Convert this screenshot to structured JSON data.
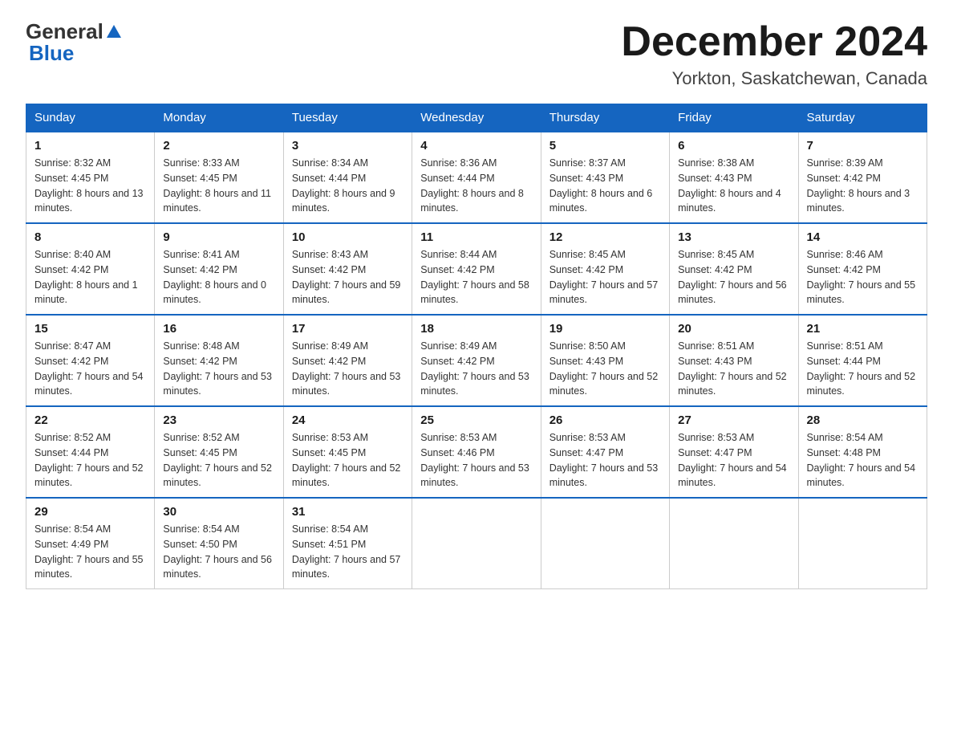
{
  "logo": {
    "part1": "General",
    "part2": "Blue"
  },
  "title": {
    "month_year": "December 2024",
    "location": "Yorkton, Saskatchewan, Canada"
  },
  "weekdays": [
    "Sunday",
    "Monday",
    "Tuesday",
    "Wednesday",
    "Thursday",
    "Friday",
    "Saturday"
  ],
  "weeks": [
    [
      {
        "day": "1",
        "sunrise": "8:32 AM",
        "sunset": "4:45 PM",
        "daylight": "8 hours and 13 minutes."
      },
      {
        "day": "2",
        "sunrise": "8:33 AM",
        "sunset": "4:45 PM",
        "daylight": "8 hours and 11 minutes."
      },
      {
        "day": "3",
        "sunrise": "8:34 AM",
        "sunset": "4:44 PM",
        "daylight": "8 hours and 9 minutes."
      },
      {
        "day": "4",
        "sunrise": "8:36 AM",
        "sunset": "4:44 PM",
        "daylight": "8 hours and 8 minutes."
      },
      {
        "day": "5",
        "sunrise": "8:37 AM",
        "sunset": "4:43 PM",
        "daylight": "8 hours and 6 minutes."
      },
      {
        "day": "6",
        "sunrise": "8:38 AM",
        "sunset": "4:43 PM",
        "daylight": "8 hours and 4 minutes."
      },
      {
        "day": "7",
        "sunrise": "8:39 AM",
        "sunset": "4:42 PM",
        "daylight": "8 hours and 3 minutes."
      }
    ],
    [
      {
        "day": "8",
        "sunrise": "8:40 AM",
        "sunset": "4:42 PM",
        "daylight": "8 hours and 1 minute."
      },
      {
        "day": "9",
        "sunrise": "8:41 AM",
        "sunset": "4:42 PM",
        "daylight": "8 hours and 0 minutes."
      },
      {
        "day": "10",
        "sunrise": "8:43 AM",
        "sunset": "4:42 PM",
        "daylight": "7 hours and 59 minutes."
      },
      {
        "day": "11",
        "sunrise": "8:44 AM",
        "sunset": "4:42 PM",
        "daylight": "7 hours and 58 minutes."
      },
      {
        "day": "12",
        "sunrise": "8:45 AM",
        "sunset": "4:42 PM",
        "daylight": "7 hours and 57 minutes."
      },
      {
        "day": "13",
        "sunrise": "8:45 AM",
        "sunset": "4:42 PM",
        "daylight": "7 hours and 56 minutes."
      },
      {
        "day": "14",
        "sunrise": "8:46 AM",
        "sunset": "4:42 PM",
        "daylight": "7 hours and 55 minutes."
      }
    ],
    [
      {
        "day": "15",
        "sunrise": "8:47 AM",
        "sunset": "4:42 PM",
        "daylight": "7 hours and 54 minutes."
      },
      {
        "day": "16",
        "sunrise": "8:48 AM",
        "sunset": "4:42 PM",
        "daylight": "7 hours and 53 minutes."
      },
      {
        "day": "17",
        "sunrise": "8:49 AM",
        "sunset": "4:42 PM",
        "daylight": "7 hours and 53 minutes."
      },
      {
        "day": "18",
        "sunrise": "8:49 AM",
        "sunset": "4:42 PM",
        "daylight": "7 hours and 53 minutes."
      },
      {
        "day": "19",
        "sunrise": "8:50 AM",
        "sunset": "4:43 PM",
        "daylight": "7 hours and 52 minutes."
      },
      {
        "day": "20",
        "sunrise": "8:51 AM",
        "sunset": "4:43 PM",
        "daylight": "7 hours and 52 minutes."
      },
      {
        "day": "21",
        "sunrise": "8:51 AM",
        "sunset": "4:44 PM",
        "daylight": "7 hours and 52 minutes."
      }
    ],
    [
      {
        "day": "22",
        "sunrise": "8:52 AM",
        "sunset": "4:44 PM",
        "daylight": "7 hours and 52 minutes."
      },
      {
        "day": "23",
        "sunrise": "8:52 AM",
        "sunset": "4:45 PM",
        "daylight": "7 hours and 52 minutes."
      },
      {
        "day": "24",
        "sunrise": "8:53 AM",
        "sunset": "4:45 PM",
        "daylight": "7 hours and 52 minutes."
      },
      {
        "day": "25",
        "sunrise": "8:53 AM",
        "sunset": "4:46 PM",
        "daylight": "7 hours and 53 minutes."
      },
      {
        "day": "26",
        "sunrise": "8:53 AM",
        "sunset": "4:47 PM",
        "daylight": "7 hours and 53 minutes."
      },
      {
        "day": "27",
        "sunrise": "8:53 AM",
        "sunset": "4:47 PM",
        "daylight": "7 hours and 54 minutes."
      },
      {
        "day": "28",
        "sunrise": "8:54 AM",
        "sunset": "4:48 PM",
        "daylight": "7 hours and 54 minutes."
      }
    ],
    [
      {
        "day": "29",
        "sunrise": "8:54 AM",
        "sunset": "4:49 PM",
        "daylight": "7 hours and 55 minutes."
      },
      {
        "day": "30",
        "sunrise": "8:54 AM",
        "sunset": "4:50 PM",
        "daylight": "7 hours and 56 minutes."
      },
      {
        "day": "31",
        "sunrise": "8:54 AM",
        "sunset": "4:51 PM",
        "daylight": "7 hours and 57 minutes."
      },
      null,
      null,
      null,
      null
    ]
  ],
  "labels": {
    "sunrise": "Sunrise:",
    "sunset": "Sunset:",
    "daylight": "Daylight:"
  }
}
